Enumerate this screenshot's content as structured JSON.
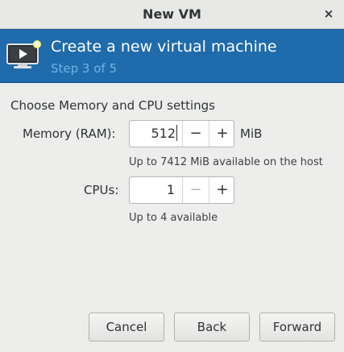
{
  "window": {
    "title": "New VM",
    "close_glyph": "×"
  },
  "banner": {
    "icon": "new-vm-monitor-icon",
    "title": "Create a new virtual machine",
    "step": "Step 3 of 5",
    "bg_color": "#1f6bab",
    "step_color": "#6fb4e8"
  },
  "form": {
    "section_title": "Choose Memory and CPU settings",
    "memory": {
      "label": "Memory (RAM):",
      "value": "512",
      "decrement": "−",
      "increment": "+",
      "unit": "MiB",
      "hint": "Up to 7412 MiB available on the host"
    },
    "cpus": {
      "label": "CPUs:",
      "value": "1",
      "decrement": "−",
      "increment": "+",
      "decrement_disabled": true,
      "hint": "Up to 4 available"
    }
  },
  "buttons": {
    "cancel": "Cancel",
    "back": "Back",
    "forward": "Forward"
  }
}
